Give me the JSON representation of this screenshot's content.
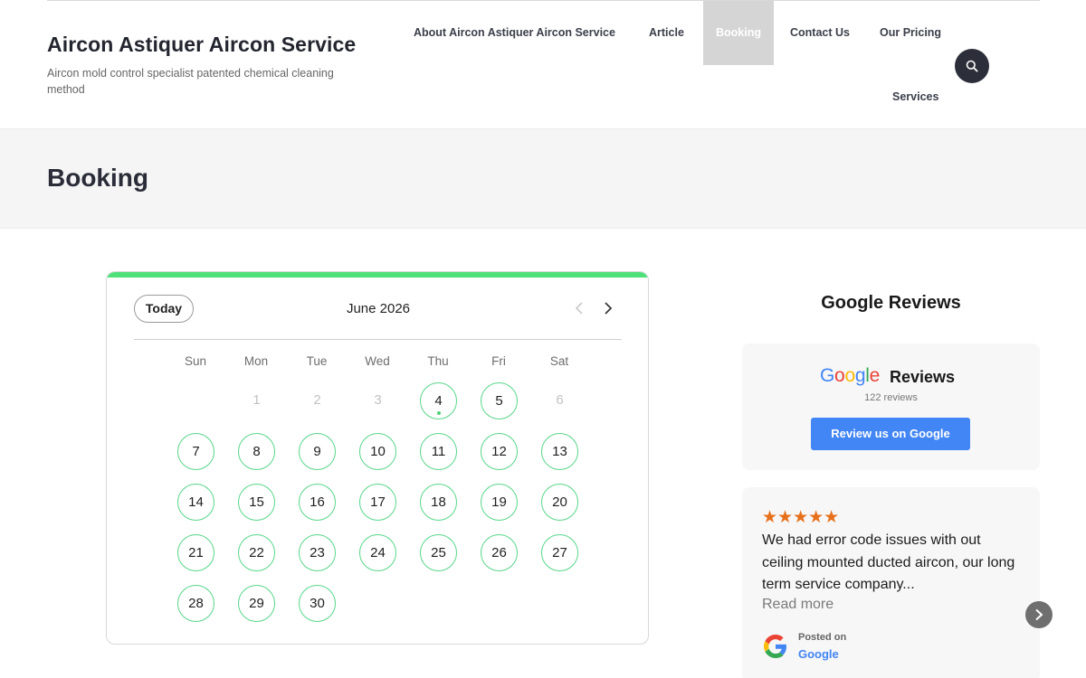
{
  "site": {
    "title": "Aircon Astiquer Aircon Service",
    "tagline": "Aircon mold control specialist patented chemical cleaning method"
  },
  "nav": {
    "items": [
      "About Aircon Astiquer Aircon Service",
      "Article",
      "Booking",
      "Contact Us",
      "Our Pricing",
      "Services"
    ],
    "active": "Booking",
    "search_icon": "search-icon"
  },
  "page": {
    "title": "Booking"
  },
  "calendar": {
    "today_label": "Today",
    "month_label": "June 2026",
    "weekdays": [
      "Sun",
      "Mon",
      "Tue",
      "Wed",
      "Thu",
      "Fri",
      "Sat"
    ],
    "muted_days": [
      "1",
      "2",
      "3",
      "6"
    ],
    "available_days": [
      "4",
      "5",
      "7",
      "8",
      "9",
      "10",
      "11",
      "12",
      "13",
      "14",
      "15",
      "16",
      "17",
      "18",
      "19",
      "20",
      "21",
      "22",
      "23",
      "24",
      "25",
      "26",
      "27",
      "28",
      "29",
      "30"
    ],
    "today_marker_day": "4",
    "accent_color": "#4fe07a",
    "available_ring_color": "#58d68a"
  },
  "reviews": {
    "heading": "Google Reviews",
    "brand_word": "Google",
    "brand_label": "Reviews",
    "count_text": "122 reviews",
    "button_label": "Review us on Google",
    "button_color": "#4285f4",
    "card": {
      "stars": "★★★★★",
      "rating": 5,
      "text": "We had error code issues with out ceiling mounted ducted aircon, our long term service company...",
      "read_more": "Read more",
      "posted_on": "Posted on",
      "source": "Google",
      "star_color": "#e7711b"
    }
  }
}
